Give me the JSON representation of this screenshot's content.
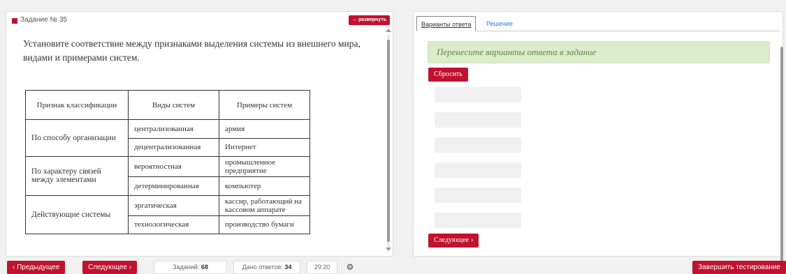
{
  "task": {
    "title": "Задание № 35",
    "expand_label": "↔ развернуть",
    "question": "Установите соответствие между признаками выделения системы из внешнего мира, видами и примерами систем.",
    "table": {
      "headers": [
        "Признак классификации",
        "Виды систем",
        "Примеры систем"
      ],
      "groups": [
        {
          "label": "По способу организации",
          "rows": [
            [
              "централизованная",
              "армия"
            ],
            [
              "децентрализованная",
              "Интернет"
            ]
          ]
        },
        {
          "label": "По характеру связей между элементами",
          "rows": [
            [
              "вероятностная",
              "промышленное предприятие"
            ],
            [
              "детерминированная",
              "компьютер"
            ]
          ]
        },
        {
          "label": "Действующие системы",
          "rows": [
            [
              "эргатическая",
              "кассир, работающий на кассовом аппарате"
            ],
            [
              "технологическая",
              "производство бумаги"
            ]
          ]
        }
      ]
    }
  },
  "answers": {
    "tabs": [
      "Варианты ответа",
      "Решение"
    ],
    "hint": "Перенесите варианты ответа в задание",
    "reset_label": "Сбросить",
    "next_label": "Следующее",
    "next_icon": "chevron-right-icon"
  },
  "bottom": {
    "prev_label": "Предыдущее",
    "next_label": "Следующее",
    "tasks_label": "Заданий:",
    "tasks_count": "68",
    "answered_label": "Дано ответов:",
    "answered_count": "34",
    "timer": "29:20",
    "settings_icon": "gear-icon",
    "finish_label": "Завершить тестирование"
  },
  "colors": {
    "accent": "#c0112e",
    "hint_bg": "#dcebcc",
    "hint_text": "#5a8a3d"
  }
}
